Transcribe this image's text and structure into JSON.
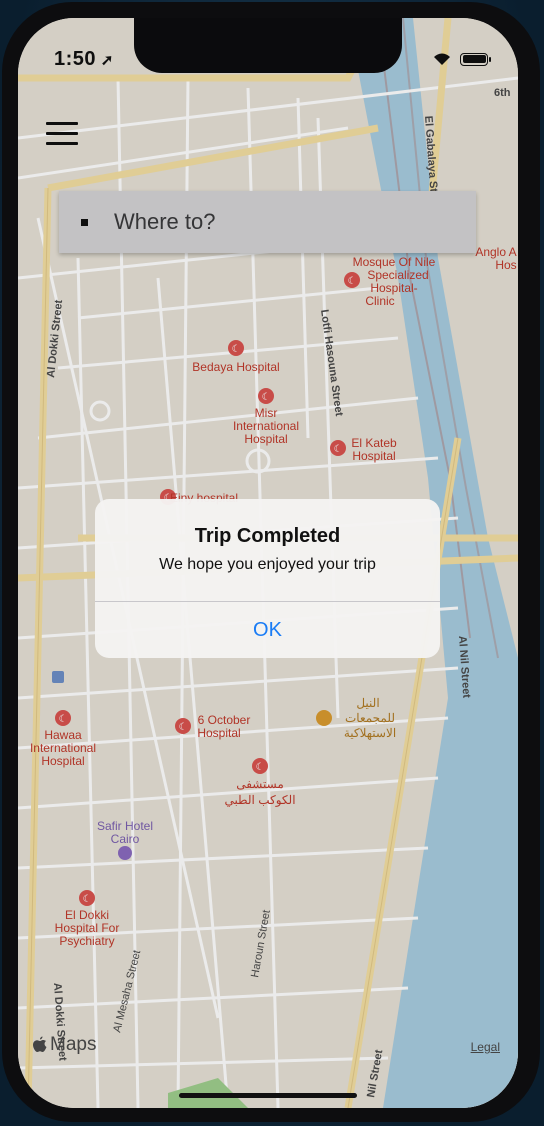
{
  "status_bar": {
    "time": "1:50"
  },
  "search": {
    "placeholder": "Where to?"
  },
  "map": {
    "street_labels": [
      "Al Dokki Street",
      "Lotfi Hasouna Street",
      "El Gabalaya St",
      "Al Nil Street",
      "Haroun Street",
      "Al Mesaha Street",
      "Al Dokki Street",
      "Nil Street",
      "6th"
    ],
    "pois": [
      "Bedaya Hospital",
      "Misr International Hospital",
      "El Kateb Hospital",
      "Mosque Of Nile Specialized Hospital- Clinic",
      "Anglo A Hos",
      "Einy hospital",
      "Hawaa International Hospital",
      "6 October Hospital",
      "النيل للمجمعات الاستهلاكية",
      "مستشفى الكوكب الطبي",
      "Safir Hotel Cairo",
      "El Dokki Hospital For Psychiatry"
    ],
    "colors": {
      "land": "#e6e1d6",
      "road": "#ffffff",
      "major_road": "#f3dfa2",
      "water": "#a8cde0",
      "poi": "#d9534f",
      "hotel": "#8a6bbf"
    }
  },
  "footer": {
    "maps_logo": "Maps",
    "legal": "Legal"
  },
  "alert": {
    "title": "Trip Completed",
    "message": "We hope you enjoyed your trip",
    "ok": "OK"
  }
}
